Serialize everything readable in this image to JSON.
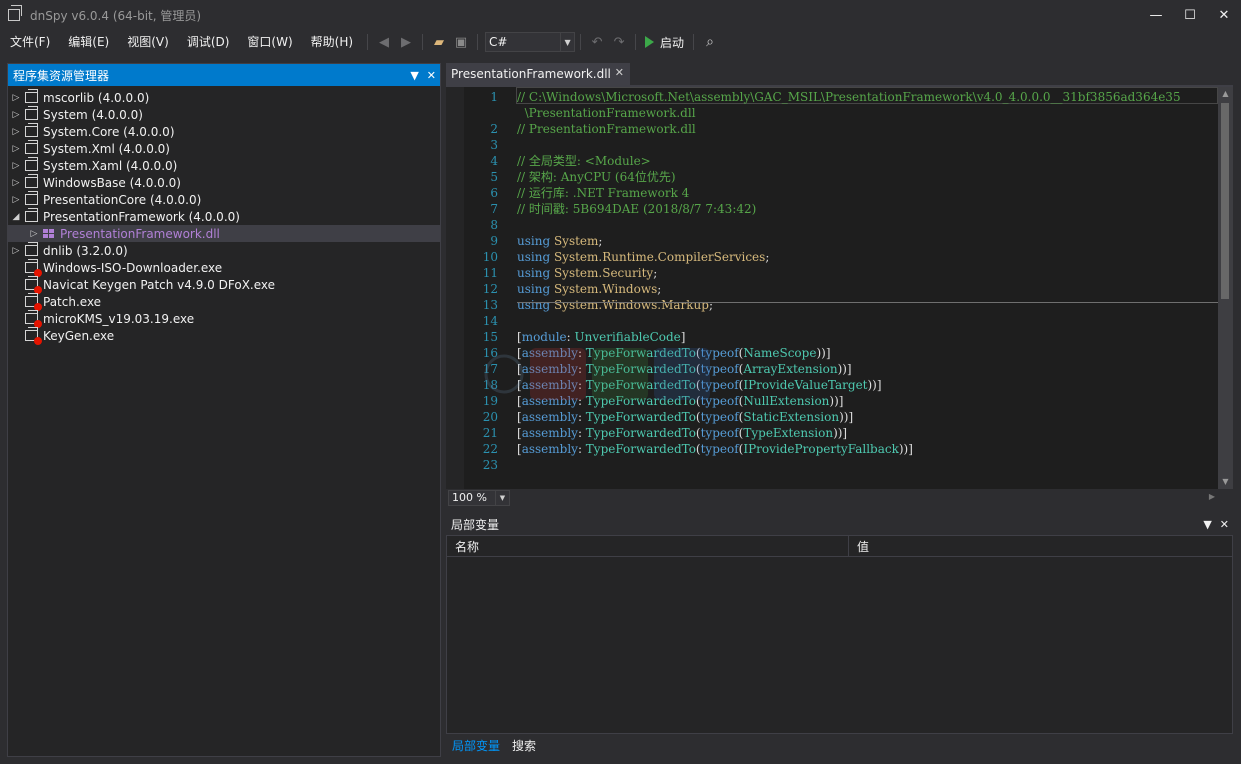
{
  "window": {
    "title": "dnSpy v6.0.4 (64-bit, 管理员)",
    "controls": {
      "minimize": "—",
      "maximize": "☐",
      "close": "✕"
    }
  },
  "menu": [
    "文件(F)",
    "编辑(E)",
    "视图(V)",
    "调试(D)",
    "窗口(W)",
    "帮助(H)"
  ],
  "toolbar": {
    "language": "C#",
    "start_label": "启动"
  },
  "assembly_explorer": {
    "title": "程序集资源管理器",
    "items": [
      {
        "label": "mscorlib (4.0.0.0)",
        "kind": "assembly",
        "expand": "collapsed"
      },
      {
        "label": "System (4.0.0.0)",
        "kind": "assembly",
        "expand": "collapsed"
      },
      {
        "label": "System.Core (4.0.0.0)",
        "kind": "assembly",
        "expand": "collapsed"
      },
      {
        "label": "System.Xml (4.0.0.0)",
        "kind": "assembly",
        "expand": "collapsed"
      },
      {
        "label": "System.Xaml (4.0.0.0)",
        "kind": "assembly",
        "expand": "collapsed"
      },
      {
        "label": "WindowsBase (4.0.0.0)",
        "kind": "assembly",
        "expand": "collapsed"
      },
      {
        "label": "PresentationCore (4.0.0.0)",
        "kind": "assembly",
        "expand": "collapsed"
      },
      {
        "label": "PresentationFramework (4.0.0.0)",
        "kind": "assembly",
        "expand": "expanded"
      },
      {
        "label": "PresentationFramework.dll",
        "kind": "module",
        "expand": "collapsed",
        "selected": true
      },
      {
        "label": "dnlib (3.2.0.0)",
        "kind": "assembly",
        "expand": "collapsed"
      },
      {
        "label": "Windows-ISO-Downloader.exe",
        "kind": "exe",
        "expand": "none"
      },
      {
        "label": "Navicat Keygen Patch v4.9.0 DFoX.exe",
        "kind": "exe",
        "expand": "none"
      },
      {
        "label": "Patch.exe",
        "kind": "exe",
        "expand": "none"
      },
      {
        "label": "microKMS_v19.03.19.exe",
        "kind": "exe",
        "expand": "none"
      },
      {
        "label": "KeyGen.exe",
        "kind": "exe",
        "expand": "none"
      }
    ]
  },
  "document_tab": {
    "title": "PresentationFramework.dll"
  },
  "code": {
    "lines": [
      {
        "n": "1",
        "parts": [
          [
            "cm",
            "// C:\\Windows\\Microsoft.Net\\assembly\\GAC_MSIL\\PresentationFramework\\v4.0_4.0.0.0__31bf3856ad364e35"
          ]
        ]
      },
      {
        "n": "",
        "parts": [
          [
            "cm",
            "  \\PresentationFramework.dll"
          ]
        ]
      },
      {
        "n": "2",
        "parts": [
          [
            "cm",
            "// PresentationFramework.dll"
          ]
        ]
      },
      {
        "n": "3",
        "parts": []
      },
      {
        "n": "4",
        "parts": [
          [
            "cm",
            "// 全局类型: <Module>"
          ]
        ]
      },
      {
        "n": "5",
        "parts": [
          [
            "cm",
            "// 架构: AnyCPU (64位优先)"
          ]
        ]
      },
      {
        "n": "6",
        "parts": [
          [
            "cm",
            "// 运行库: .NET Framework 4"
          ]
        ]
      },
      {
        "n": "7",
        "parts": [
          [
            "cm",
            "// 时间戳: 5B694DAE (2018/8/7 7:43:42)"
          ]
        ]
      },
      {
        "n": "8",
        "parts": []
      },
      {
        "n": "9",
        "parts": [
          [
            "kw",
            "using "
          ],
          [
            "ns",
            "System"
          ],
          [
            "txt",
            ";"
          ]
        ]
      },
      {
        "n": "10",
        "parts": [
          [
            "kw",
            "using "
          ],
          [
            "ns",
            "System.Runtime.CompilerServices"
          ],
          [
            "txt",
            ";"
          ]
        ]
      },
      {
        "n": "11",
        "parts": [
          [
            "kw",
            "using "
          ],
          [
            "ns",
            "System.Security"
          ],
          [
            "txt",
            ";"
          ]
        ]
      },
      {
        "n": "12",
        "parts": [
          [
            "kw",
            "using "
          ],
          [
            "ns",
            "System.Windows"
          ],
          [
            "txt",
            ";"
          ]
        ]
      },
      {
        "n": "13",
        "parts": [
          [
            "kw",
            "using "
          ],
          [
            "ns",
            "System.Windows.Markup"
          ],
          [
            "txt",
            ";"
          ]
        ]
      },
      {
        "n": "14",
        "parts": []
      },
      {
        "n": "15",
        "parts": [
          [
            "txt",
            "["
          ],
          [
            "kw",
            "module"
          ],
          [
            "txt",
            ": "
          ],
          [
            "ty",
            "UnverifiableCode"
          ],
          [
            "txt",
            "]"
          ]
        ]
      },
      {
        "n": "16",
        "parts": [
          [
            "txt",
            "["
          ],
          [
            "kw",
            "assembly"
          ],
          [
            "txt",
            ": "
          ],
          [
            "ty",
            "TypeForwardedTo"
          ],
          [
            "txt",
            "("
          ],
          [
            "kw",
            "typeof"
          ],
          [
            "txt",
            "("
          ],
          [
            "ty",
            "NameScope"
          ],
          [
            "txt",
            "))]"
          ]
        ]
      },
      {
        "n": "17",
        "parts": [
          [
            "txt",
            "["
          ],
          [
            "kw",
            "assembly"
          ],
          [
            "txt",
            ": "
          ],
          [
            "ty",
            "TypeForwardedTo"
          ],
          [
            "txt",
            "("
          ],
          [
            "kw",
            "typeof"
          ],
          [
            "txt",
            "("
          ],
          [
            "ty",
            "ArrayExtension"
          ],
          [
            "txt",
            "))]"
          ]
        ]
      },
      {
        "n": "18",
        "parts": [
          [
            "txt",
            "["
          ],
          [
            "kw",
            "assembly"
          ],
          [
            "txt",
            ": "
          ],
          [
            "ty",
            "TypeForwardedTo"
          ],
          [
            "txt",
            "("
          ],
          [
            "kw",
            "typeof"
          ],
          [
            "txt",
            "("
          ],
          [
            "ty",
            "IProvideValueTarget"
          ],
          [
            "txt",
            "))]"
          ]
        ]
      },
      {
        "n": "19",
        "parts": [
          [
            "txt",
            "["
          ],
          [
            "kw",
            "assembly"
          ],
          [
            "txt",
            ": "
          ],
          [
            "ty",
            "TypeForwardedTo"
          ],
          [
            "txt",
            "("
          ],
          [
            "kw",
            "typeof"
          ],
          [
            "txt",
            "("
          ],
          [
            "ty",
            "NullExtension"
          ],
          [
            "txt",
            "))]"
          ]
        ]
      },
      {
        "n": "20",
        "parts": [
          [
            "txt",
            "["
          ],
          [
            "kw",
            "assembly"
          ],
          [
            "txt",
            ": "
          ],
          [
            "ty",
            "TypeForwardedTo"
          ],
          [
            "txt",
            "("
          ],
          [
            "kw",
            "typeof"
          ],
          [
            "txt",
            "("
          ],
          [
            "ty",
            "StaticExtension"
          ],
          [
            "txt",
            "))]"
          ]
        ]
      },
      {
        "n": "21",
        "parts": [
          [
            "txt",
            "["
          ],
          [
            "kw",
            "assembly"
          ],
          [
            "txt",
            ": "
          ],
          [
            "ty",
            "TypeForwardedTo"
          ],
          [
            "txt",
            "("
          ],
          [
            "kw",
            "typeof"
          ],
          [
            "txt",
            "("
          ],
          [
            "ty",
            "TypeExtension"
          ],
          [
            "txt",
            "))]"
          ]
        ]
      },
      {
        "n": "22",
        "parts": [
          [
            "txt",
            "["
          ],
          [
            "kw",
            "assembly"
          ],
          [
            "txt",
            ": "
          ],
          [
            "ty",
            "TypeForwardedTo"
          ],
          [
            "txt",
            "("
          ],
          [
            "kw",
            "typeof"
          ],
          [
            "txt",
            "("
          ],
          [
            "ty",
            "IProvidePropertyFallback"
          ],
          [
            "txt",
            "))]"
          ]
        ]
      },
      {
        "n": "23",
        "parts": []
      }
    ]
  },
  "zoom": {
    "value": "100 %"
  },
  "locals": {
    "title": "局部变量",
    "columns": [
      "名称",
      "值"
    ],
    "tabs": [
      "局部变量",
      "搜索"
    ]
  },
  "colors": {
    "accent": "#007acc",
    "comment": "#57a64a",
    "keyword": "#569cd6",
    "namespace": "#d7ba7d",
    "type": "#4ec9b0",
    "line_number": "#2b91af",
    "selected_module": "#b180d7"
  }
}
